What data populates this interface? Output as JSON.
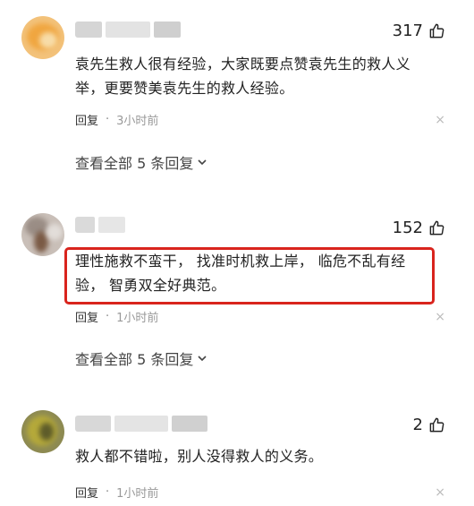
{
  "comments": [
    {
      "likes": "317",
      "text": "袁先生救人很有经验，大家既要点赞袁先生的救人义举，更要赞美袁先生的救人经验。",
      "reply_label": "回复",
      "separator": "·",
      "time": "3小时前",
      "more_replies": "查看全部 5 条回复",
      "close_glyph": "×"
    },
    {
      "likes": "152",
      "text": "理性施救不蛮干， 找准时机救上岸， 临危不乱有经验， 智勇双全好典范。",
      "reply_label": "回复",
      "separator": "·",
      "time": "1小时前",
      "more_replies": "查看全部 5 条回复",
      "close_glyph": "×"
    },
    {
      "likes": "2",
      "text": "救人都不错啦，别人没得救人的义务。",
      "reply_label": "回复",
      "separator": "·",
      "time": "1小时前",
      "close_glyph": "×"
    }
  ],
  "colors": {
    "highlight": "#d9241d",
    "meta_time": "#999999",
    "close": "#bbbbbb"
  },
  "icons": {
    "like": "thumbs-up-icon",
    "close": "close-icon",
    "expand": "chevron-down-icon"
  }
}
